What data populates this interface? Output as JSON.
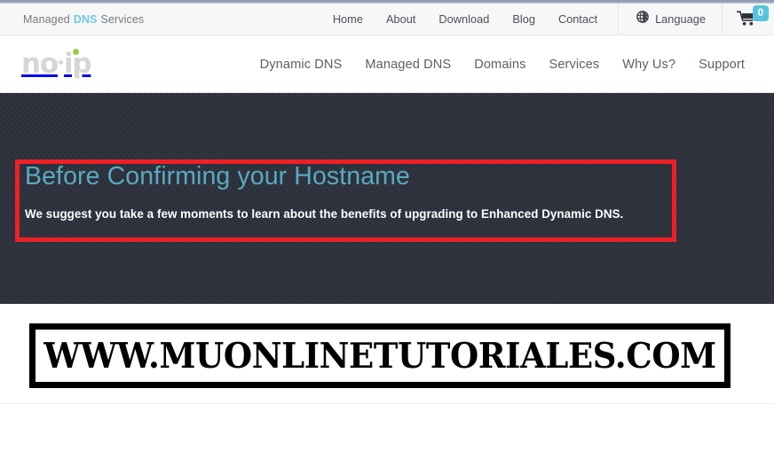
{
  "topbar": {
    "tagline_pre": "Managed",
    "tagline_accent": "DNS",
    "tagline_post": "Services",
    "nav": [
      {
        "label": "Home"
      },
      {
        "label": "About"
      },
      {
        "label": "Download"
      },
      {
        "label": "Blog"
      },
      {
        "label": "Contact"
      }
    ],
    "language": {
      "icon": "globe-icon",
      "label": "Language"
    },
    "cart": {
      "icon": "shopping-cart-icon",
      "count": "0"
    }
  },
  "brand": {
    "name": "no-ip",
    "part_one": "no",
    "part_two": "ip"
  },
  "mainnav": [
    {
      "label": "Dynamic DNS"
    },
    {
      "label": "Managed DNS"
    },
    {
      "label": "Domains"
    },
    {
      "label": "Services"
    },
    {
      "label": "Why Us?"
    },
    {
      "label": "Support"
    }
  ],
  "hero": {
    "title": "Before Confirming your Hostname",
    "subtitle": "We suggest you take a few moments to learn about the benefits of upgrading to Enhanced Dynamic DNS.",
    "background_color": "#2b303b",
    "title_color": "#5aa9c0"
  },
  "annotation": {
    "type": "rectangle-highlight",
    "color": "#ef2025"
  },
  "watermark": {
    "text": "WWW.MUONLINETUTORIALES.COM"
  }
}
